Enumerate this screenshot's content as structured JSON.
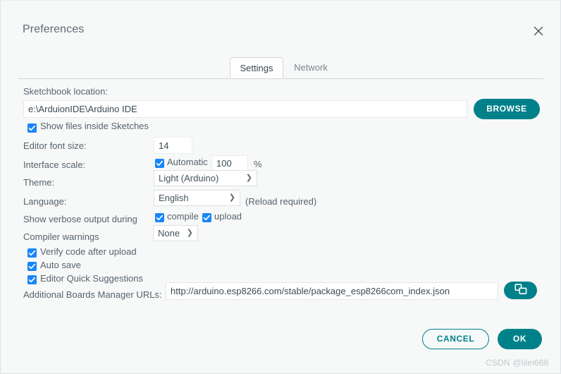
{
  "dialog": {
    "title": "Preferences",
    "close_icon": "close-icon"
  },
  "tabs": [
    {
      "id": "settings",
      "label": "Settings",
      "active": true
    },
    {
      "id": "network",
      "label": "Network",
      "active": false
    }
  ],
  "settings": {
    "sketchbook": {
      "label": "Sketchbook location:",
      "value": "e:\\ArduionIDE\\Arduino IDE",
      "placeholder": "",
      "browse_label": "BROWSE"
    },
    "show_files_inside_sketches": {
      "label": "Show files inside Sketches",
      "checked": true
    },
    "editor_font_size": {
      "label": "Editor font size:",
      "value": "14"
    },
    "interface_scale": {
      "label": "Interface scale:",
      "automatic_label": "Automatic",
      "automatic_checked": true,
      "value": "100",
      "unit": "%"
    },
    "theme": {
      "label": "Theme:",
      "value": "Light (Arduino)",
      "options": [
        "Light (Arduino)"
      ],
      "caret_icon": "chevron-down-icon"
    },
    "language": {
      "label": "Language:",
      "value": "English",
      "options": [
        "English"
      ],
      "note": "(Reload required)",
      "caret_icon": "chevron-down-icon"
    },
    "verbose_output": {
      "label": "Show verbose output during",
      "compile_label": "compile",
      "compile_checked": true,
      "upload_label": "upload",
      "upload_checked": true
    },
    "compiler_warnings": {
      "label": "Compiler warnings",
      "value": "None",
      "options": [
        "None"
      ],
      "caret_icon": "chevron-down-icon"
    },
    "verify_code_after_upload": {
      "label": "Verify code after upload",
      "checked": true
    },
    "auto_save": {
      "label": "Auto save",
      "checked": true
    },
    "editor_quick_suggestions": {
      "label": "Editor Quick Suggestions",
      "checked": true
    },
    "additional_urls": {
      "label": "Additional Boards Manager URLs:",
      "value": "http://arduino.esp8266.com/stable/package_esp8266com_index.json",
      "placeholder": "",
      "button_icon": "copy-windows-icon"
    }
  },
  "footer": {
    "cancel_label": "CANCEL",
    "ok_label": "OK"
  },
  "watermark": "CSDN @lilei668",
  "colors": {
    "accent_teal": "#00818a",
    "checkbox_blue": "#1a85f7",
    "dialog_bg": "#f7f8f8",
    "text": "#56646c"
  }
}
